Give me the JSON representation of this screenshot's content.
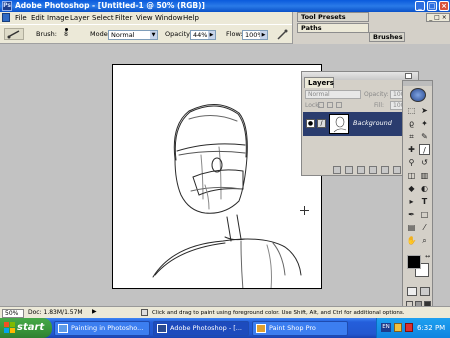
{
  "window": {
    "title": "Adobe Photoshop - [Untitled-1 @ 50% (RGB)]",
    "buttons": [
      "_",
      "□",
      "×"
    ]
  },
  "menu": {
    "logo_icon": "photoshop-icon",
    "items": [
      "File",
      "Edit",
      "Image",
      "Layer",
      "Select",
      "Filter",
      "View",
      "Window",
      "Help"
    ],
    "doc_buttons": [
      "_",
      "□",
      "×"
    ]
  },
  "options": {
    "tool_icon": "brush-icon",
    "brush_label": "Brush:",
    "brush_size": "8",
    "mode_label": "Mode:",
    "mode_value": "Normal",
    "opacity_label": "Opacity:",
    "opacity_value": "44%",
    "flow_label": "Flow:",
    "flow_value": "100%"
  },
  "palette_well": {
    "tabs": [
      "Tool Presets",
      "Paths",
      "Brushes"
    ]
  },
  "layers_panel": {
    "tab": "Layers",
    "blend_mode": "Normal",
    "opacity_label": "Opacity:",
    "opacity_value": "100%",
    "lock_label": "Lock:",
    "fill_label": "Fill:",
    "fill_value": "100%",
    "layer_name": "Background"
  },
  "status": {
    "zoom": "50%",
    "doc_info": "Doc: 1.83M/1.57M",
    "hint": "Click and drag to paint using foreground color. Use Shift, Alt, and Ctrl for additional options."
  },
  "taskbar": {
    "start_label": "start",
    "tasks": [
      "Painting in Photosho...",
      "Adobe Photoshop - [...",
      "Paint Shop Pro"
    ],
    "language": "EN",
    "clock": "6:32 PM"
  },
  "colors": {
    "titlebar": "#0a5adc",
    "taskbar": "#245edb",
    "start_button": "#3a983b",
    "layer_selected": "#2a3c6e",
    "workspace": "#c2c2c2"
  }
}
